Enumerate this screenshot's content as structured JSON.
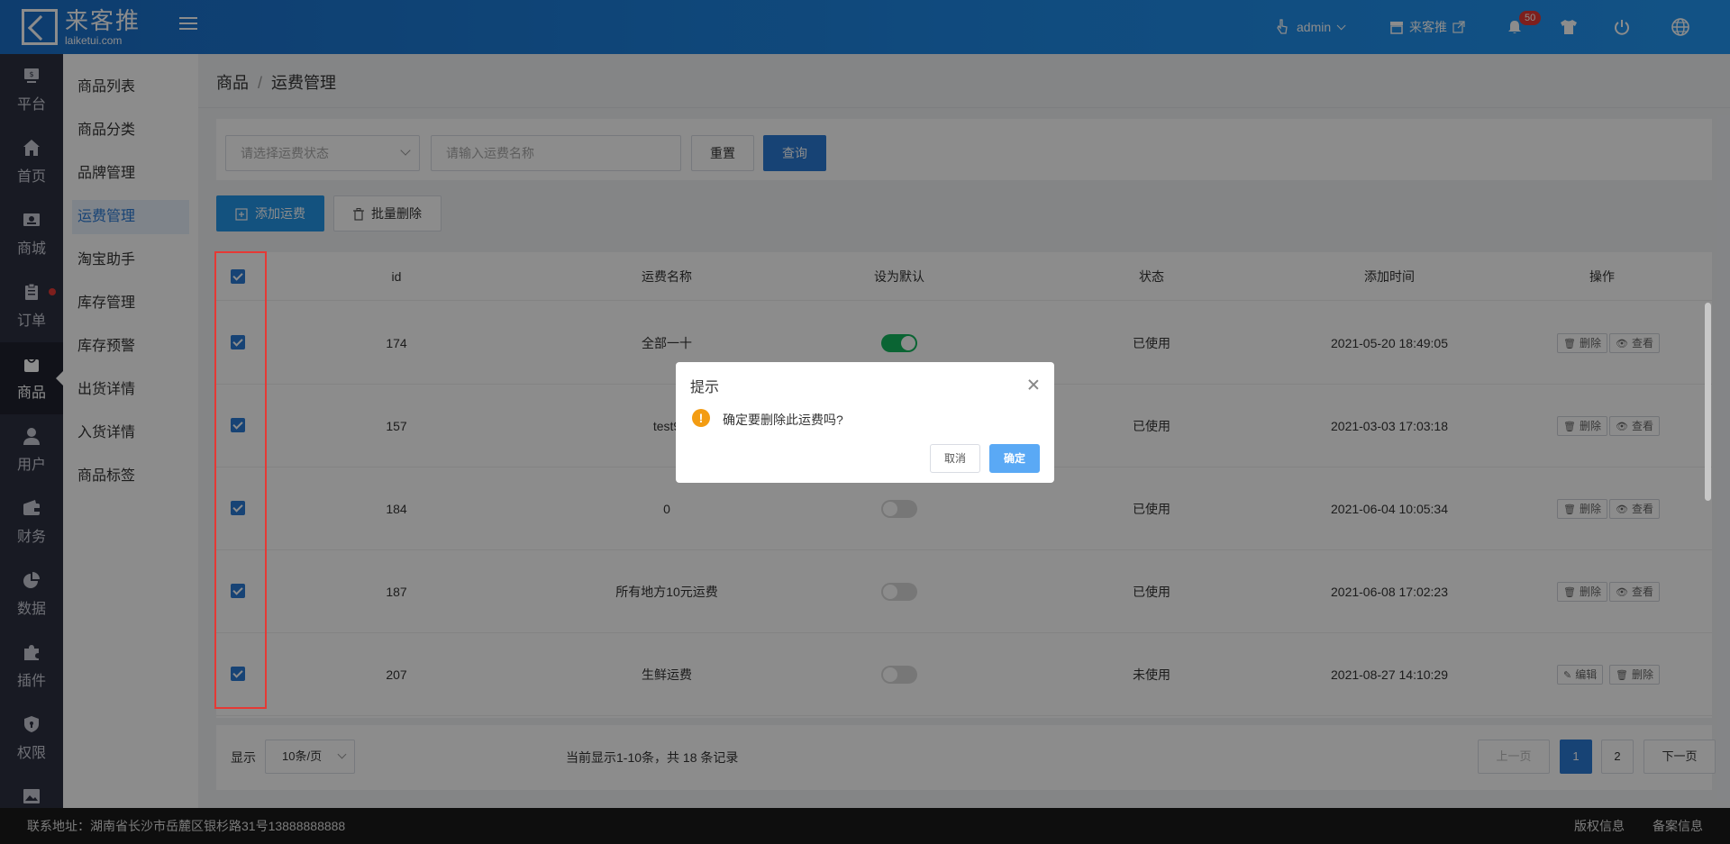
{
  "header": {
    "logo_cn": "来客推",
    "logo_en": "laiketui.com",
    "user": "admin",
    "store": "来客推",
    "notifications": "50"
  },
  "icon_nav": [
    {
      "label": "平台",
      "icon": "platform-icon"
    },
    {
      "label": "首页",
      "icon": "home-icon"
    },
    {
      "label": "商城",
      "icon": "mall-icon"
    },
    {
      "label": "订单",
      "icon": "order-icon"
    },
    {
      "label": "商品",
      "icon": "bag-icon"
    },
    {
      "label": "用户",
      "icon": "user-icon"
    },
    {
      "label": "财务",
      "icon": "wallet-icon"
    },
    {
      "label": "数据",
      "icon": "pie-chart-icon"
    },
    {
      "label": "插件",
      "icon": "puzzle-icon"
    },
    {
      "label": "权限",
      "icon": "shield-icon"
    },
    {
      "label": "",
      "icon": "image-icon"
    }
  ],
  "sub_nav": [
    "商品列表",
    "商品分类",
    "品牌管理",
    "运费管理",
    "淘宝助手",
    "库存管理",
    "库存预警",
    "出货详情",
    "入货详情",
    "商品标签"
  ],
  "breadcrumb": {
    "root": "商品",
    "sep": "/",
    "current": "运费管理"
  },
  "filters": {
    "status_placeholder": "请选择运费状态",
    "name_placeholder": "请输入运费名称",
    "reset": "重置",
    "query": "查询"
  },
  "actions": {
    "add": "添加运费",
    "batch_delete": "批量删除"
  },
  "table": {
    "columns": [
      "id",
      "运费名称",
      "设为默认",
      "状态",
      "添加时间",
      "操作"
    ],
    "rows": [
      {
        "id": "174",
        "name": "全部一十",
        "default": true,
        "status": "已使用",
        "time": "2021-05-20 18:49:05",
        "btn1": "删除",
        "btn2": "查看"
      },
      {
        "id": "157",
        "name": "test9",
        "default": false,
        "status": "已使用",
        "time": "2021-03-03 17:03:18",
        "btn1": "删除",
        "btn2": "查看"
      },
      {
        "id": "184",
        "name": "0",
        "default": false,
        "status": "已使用",
        "time": "2021-06-04 10:05:34",
        "btn1": "删除",
        "btn2": "查看"
      },
      {
        "id": "187",
        "name": "所有地方10元运费",
        "default": false,
        "status": "已使用",
        "time": "2021-06-08 17:02:23",
        "btn1": "删除",
        "btn2": "查看"
      },
      {
        "id": "207",
        "name": "生鲜运费",
        "default": false,
        "status": "未使用",
        "time": "2021-08-27 14:10:29",
        "btn1": "编辑",
        "btn2": "删除"
      }
    ]
  },
  "pagination": {
    "show_label": "显示",
    "page_size": "10条/页",
    "summary": "当前显示1-10条，共 18 条记录",
    "prev": "上一页",
    "pages": [
      "1",
      "2"
    ],
    "next": "下一页"
  },
  "footer": {
    "address": "联系地址：湖南省长沙市岳麓区银杉路31号13888888888",
    "copyright": "版权信息",
    "icp": "备案信息"
  },
  "dialog": {
    "title": "提示",
    "message": "确定要删除此运费吗?",
    "cancel": "取消",
    "ok": "确定"
  }
}
